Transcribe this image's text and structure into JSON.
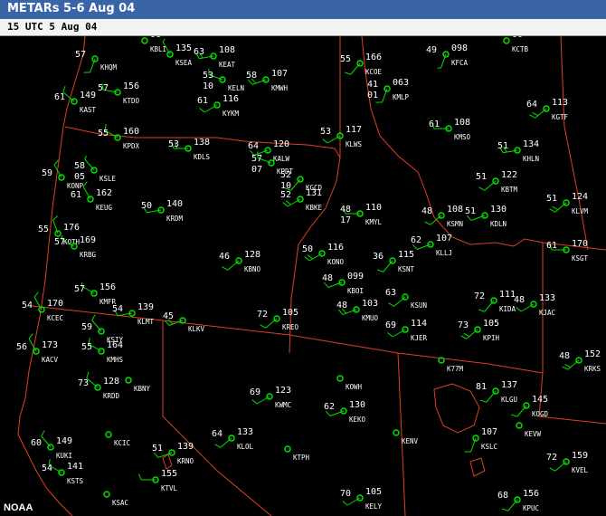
{
  "header": {
    "title": "METARs 5-6 Aug 04",
    "subtitle": "15 UTC 5 Aug 04"
  },
  "credit": "NOAA",
  "colors": {
    "background": "#000000",
    "title_bar": "#3a64a8",
    "boundaries": "#e0401e",
    "temperature": "#ffffff",
    "dewpoint": "#ffffff",
    "wind_barb": "#00e000",
    "station_circle": "#00e000",
    "station_id": "#ffffff"
  },
  "stations": [
    {
      "id": "KHQM",
      "t": "57",
      "d": "",
      "p": ""
    },
    {
      "id": "KSEA",
      "t": "",
      "d": "",
      "p": "135"
    },
    {
      "id": "KBLI",
      "t": "",
      "d": "",
      "p": "06"
    },
    {
      "id": "KEAT",
      "t": "63",
      "d": "",
      "p": "108"
    },
    {
      "id": "KELN",
      "t": "53",
      "d": "10",
      "p": ""
    },
    {
      "id": "KMWH",
      "t": "58",
      "d": "",
      "p": "107"
    },
    {
      "id": "KCOE",
      "t": "55",
      "d": "",
      "p": "166"
    },
    {
      "id": "KFCA",
      "t": "49",
      "d": "",
      "p": "098"
    },
    {
      "id": "KCTB",
      "t": "",
      "d": "",
      "p": "00"
    },
    {
      "id": "KAST",
      "t": "61",
      "d": "",
      "p": "149"
    },
    {
      "id": "KTDO",
      "t": "57",
      "d": "",
      "p": "156"
    },
    {
      "id": "KYKM",
      "t": "61",
      "d": "",
      "p": "116"
    },
    {
      "id": "KMLP",
      "t": "41",
      "d": "01",
      "p": "063"
    },
    {
      "id": "KGTF",
      "t": "64",
      "d": "",
      "p": "113"
    },
    {
      "id": "KMSO",
      "t": "61",
      "d": "",
      "p": "108"
    },
    {
      "id": "KPDX",
      "t": "55",
      "d": "",
      "p": "160"
    },
    {
      "id": "KDLS",
      "t": "53",
      "d": "",
      "p": "138"
    },
    {
      "id": "KALW",
      "t": "64",
      "d": "",
      "p": "120"
    },
    {
      "id": "KLWS",
      "t": "53",
      "d": "",
      "p": "117"
    },
    {
      "id": "KHLN",
      "t": "51",
      "d": "",
      "p": "134"
    },
    {
      "id": "KSLE",
      "t": "58",
      "d": "05",
      "p": ""
    },
    {
      "id": "KPDT",
      "t": "57",
      "d": "07",
      "p": ""
    },
    {
      "id": "KBTM",
      "t": "51",
      "d": "",
      "p": "122"
    },
    {
      "id": "KONP",
      "t": "59",
      "d": "",
      "p": ""
    },
    {
      "id": "KGCD",
      "t": "52",
      "d": "10",
      "p": ""
    },
    {
      "id": "KBKE",
      "t": "52",
      "d": "",
      "p": "131"
    },
    {
      "id": "KEUG",
      "t": "61",
      "d": "",
      "p": "162"
    },
    {
      "id": "KRDM",
      "t": "50",
      "d": "",
      "p": "140"
    },
    {
      "id": "KMYL",
      "t": "48",
      "d": "17",
      "p": "110"
    },
    {
      "id": "KSMN",
      "t": "48",
      "d": "",
      "p": "108"
    },
    {
      "id": "KDLN",
      "t": "51",
      "d": "",
      "p": "130"
    },
    {
      "id": "KLVM",
      "t": "51",
      "d": "",
      "p": "124"
    },
    {
      "id": "KOTH",
      "t": "55",
      "d": "",
      "p": "176"
    },
    {
      "id": "KRBG",
      "t": "57",
      "d": "",
      "p": "169"
    },
    {
      "id": "KBNO",
      "t": "46",
      "d": "",
      "p": "128"
    },
    {
      "id": "KONO",
      "t": "50",
      "d": "",
      "p": "116"
    },
    {
      "id": "KSNT",
      "t": "36",
      "d": "",
      "p": "115"
    },
    {
      "id": "KLLJ",
      "t": "62",
      "d": "",
      "p": "107"
    },
    {
      "id": "KSGT",
      "t": "61",
      "d": "",
      "p": "170"
    },
    {
      "id": "KMFR",
      "t": "57",
      "d": "",
      "p": "156"
    },
    {
      "id": "KBOI",
      "t": "48",
      "d": "",
      "p": "099"
    },
    {
      "id": "KSUN",
      "t": "63",
      "d": "",
      "p": ""
    },
    {
      "id": "KIDA",
      "t": "72",
      "d": "",
      "p": "111"
    },
    {
      "id": "KCEC",
      "t": "54",
      "d": "",
      "p": "170"
    },
    {
      "id": "KLMT",
      "t": "54",
      "d": "",
      "p": "139"
    },
    {
      "id": "KREO",
      "t": "72",
      "d": "",
      "p": "105"
    },
    {
      "id": "KMUO",
      "t": "48",
      "d": "",
      "p": "103"
    },
    {
      "id": "KJER",
      "t": "69",
      "d": "",
      "p": "114"
    },
    {
      "id": "KPIH",
      "t": "73",
      "d": "",
      "p": "105"
    },
    {
      "id": "KJAC",
      "t": "48",
      "d": "",
      "p": "133"
    },
    {
      "id": "KSIY",
      "t": "59",
      "d": "",
      "p": ""
    },
    {
      "id": "KLKV",
      "t": "45",
      "d": "",
      "p": ""
    },
    {
      "id": "KACV",
      "t": "56",
      "d": "",
      "p": "173"
    },
    {
      "id": "KMHS",
      "t": "55",
      "d": "",
      "p": "164"
    },
    {
      "id": "K77M",
      "t": "",
      "d": "",
      "p": ""
    },
    {
      "id": "KRKS",
      "t": "48",
      "d": "",
      "p": "152"
    },
    {
      "id": "KRDD",
      "t": "73",
      "d": "",
      "p": "128"
    },
    {
      "id": "KBNY",
      "t": "",
      "d": "",
      "p": ""
    },
    {
      "id": "KWMC",
      "t": "69",
      "d": "",
      "p": "123"
    },
    {
      "id": "KOWH",
      "t": "",
      "d": "",
      "p": ""
    },
    {
      "id": "KEKO",
      "t": "62",
      "d": "",
      "p": "130"
    },
    {
      "id": "KLGU",
      "t": "81",
      "d": "",
      "p": "137"
    },
    {
      "id": "KOGD",
      "t": "",
      "d": "",
      "p": "145"
    },
    {
      "id": "KCIC",
      "t": "",
      "d": "",
      "p": ""
    },
    {
      "id": "KLOL",
      "t": "64",
      "d": "",
      "p": "133"
    },
    {
      "id": "KENV",
      "t": "",
      "d": "",
      "p": ""
    },
    {
      "id": "KSLC",
      "t": "",
      "d": "",
      "p": "107"
    },
    {
      "id": "KEVW",
      "t": "",
      "d": "",
      "p": ""
    },
    {
      "id": "KUKI",
      "t": "60",
      "d": "",
      "p": "149"
    },
    {
      "id": "KRNO",
      "t": "51",
      "d": "",
      "p": "139"
    },
    {
      "id": "KTPH",
      "t": "",
      "d": "",
      "p": ""
    },
    {
      "id": "KELY",
      "t": "70",
      "d": "",
      "p": "105"
    },
    {
      "id": "KVEL",
      "t": "72",
      "d": "",
      "p": "159"
    },
    {
      "id": "KSTS",
      "t": "54",
      "d": "",
      "p": "141"
    },
    {
      "id": "KSAC",
      "t": "",
      "d": "",
      "p": ""
    },
    {
      "id": "KTVL",
      "t": "",
      "d": "",
      "p": "155"
    },
    {
      "id": "KPUC",
      "t": "68",
      "d": "",
      "p": "156"
    }
  ]
}
